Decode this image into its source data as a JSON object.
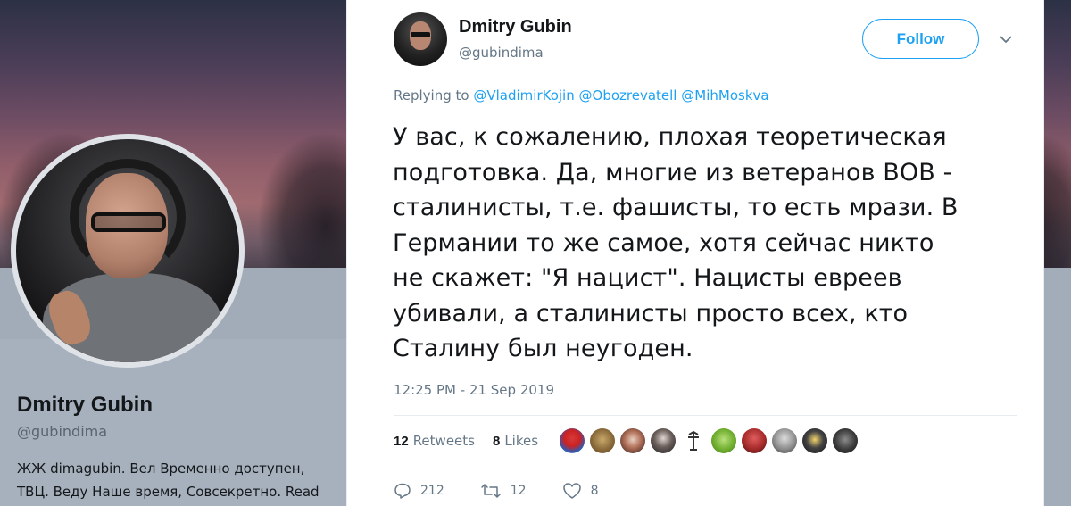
{
  "background_profile": {
    "name": "Dmitry Gubin",
    "handle": "@gubindima",
    "bio_line1": "ЖЖ dimagubin. Вел Временно доступен,",
    "bio_line2": "ТВЦ. Веду Наше время, Совсекретно. Read"
  },
  "tweet": {
    "author_name": "Dmitry Gubin",
    "author_handle": "@gubindima",
    "follow_label": "Follow",
    "replying_prefix": "Replying to",
    "reply_to": [
      "@VladimirKojin",
      "@Obozrevatell",
      "@MihMoskva"
    ],
    "text_lines": [
      "У вас, к сожалению, плохая теоретическая",
      "подготовка. Да, многие из ветеранов ВОВ -",
      "сталинисты, т.е. фашисты, то есть мрази. В",
      "Германии то же самое, хотя сейчас никто",
      "не скажет: \"Я нацист\". Нацисты евреев",
      "убивали, а сталинисты просто всех, кто",
      "Сталину был неугоден."
    ],
    "timestamp": "12:25 PM - 21 Sep 2019",
    "retweets_count": "12",
    "retweets_label": "Retweets",
    "likes_count": "8",
    "likes_label": "Likes",
    "reply_action_count": "212",
    "retweet_action_count": "12",
    "like_action_count": "8"
  },
  "colors": {
    "accent": "#1da1f2",
    "secondary_text": "#657786",
    "primary_text": "#14171a"
  }
}
